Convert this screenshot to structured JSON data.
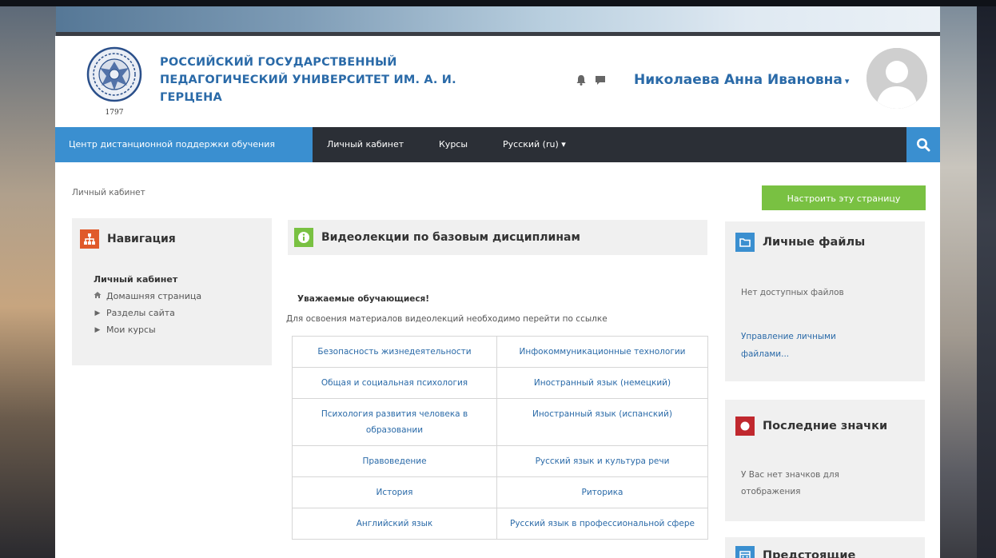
{
  "colors": {
    "brand_blue": "#3a8fd0",
    "link_blue": "#2a6aa8",
    "navbar_dark": "#2b2f36",
    "button_green": "#79c142",
    "block_bg": "#f0f0f0",
    "icon_red": "#e05a2b",
    "icon_green": "#79c142",
    "icon_blue": "#3a8fd0",
    "icon_crimson": "#c0282e"
  },
  "header": {
    "logo_year": "1797",
    "site_name_lines": [
      "РОССИЙСКИЙ ГОСУДАРСТВЕННЫЙ",
      "ПЕДАГОГИЧЕСКИЙ УНИВЕРСИТЕТ ИМ. А. И.",
      "ГЕРЦЕНА"
    ],
    "icons": [
      "notification-bell-icon",
      "messages-icon"
    ],
    "user_name": "Николаева Анна Ивановна",
    "user_caret": "▾"
  },
  "navbar": {
    "brand": "Центр дистанционной поддержки обучения",
    "items": [
      "Личный кабинет",
      "Курсы",
      "Русский (ru) ▾"
    ],
    "search_icon": "search-icon"
  },
  "breadcrumb": "Личный кабинет",
  "customize_button": "Настроить эту страницу",
  "navigation_block": {
    "title": "Навигация",
    "icon": "sitemap-icon",
    "root": "Личный кабинет",
    "items": [
      {
        "label": "Домашняя страница",
        "icon": "home-icon"
      },
      {
        "label": "Разделы сайта",
        "icon": "caret-right-icon"
      },
      {
        "label": "Мои курсы",
        "icon": "caret-right-icon"
      }
    ]
  },
  "main_block": {
    "title": "Видеолекции по базовым дисциплинам",
    "icon": "info-icon",
    "greeting": "Уважаемые обучающиеся!",
    "intro": "Для освоения материалов видеолекций необходимо перейти по ссылке",
    "courses": [
      [
        "Безопасность жизнедеятельности",
        "Инфокоммуникационные технологии"
      ],
      [
        "Общая и социальная психология",
        "Иностранный язык (немецкий)"
      ],
      [
        "Психология развития человека в образовании",
        "Иностранный язык (испанский)"
      ],
      [
        "Правоведение",
        "Русский язык и культура речи"
      ],
      [
        "История",
        "Риторика"
      ],
      [
        "Английский язык",
        "Русский язык в профессиональной сфере"
      ]
    ]
  },
  "private_files_block": {
    "title": "Личные файлы",
    "icon": "folder-icon",
    "empty_text": "Нет доступных файлов",
    "manage_link": "Управление личными файлами..."
  },
  "badges_block": {
    "title": "Последние значки",
    "icon": "badge-icon",
    "empty_text": "У Вас нет значков для отображения"
  },
  "upcoming_block": {
    "title": "Предстоящие",
    "icon": "calendar-icon"
  }
}
